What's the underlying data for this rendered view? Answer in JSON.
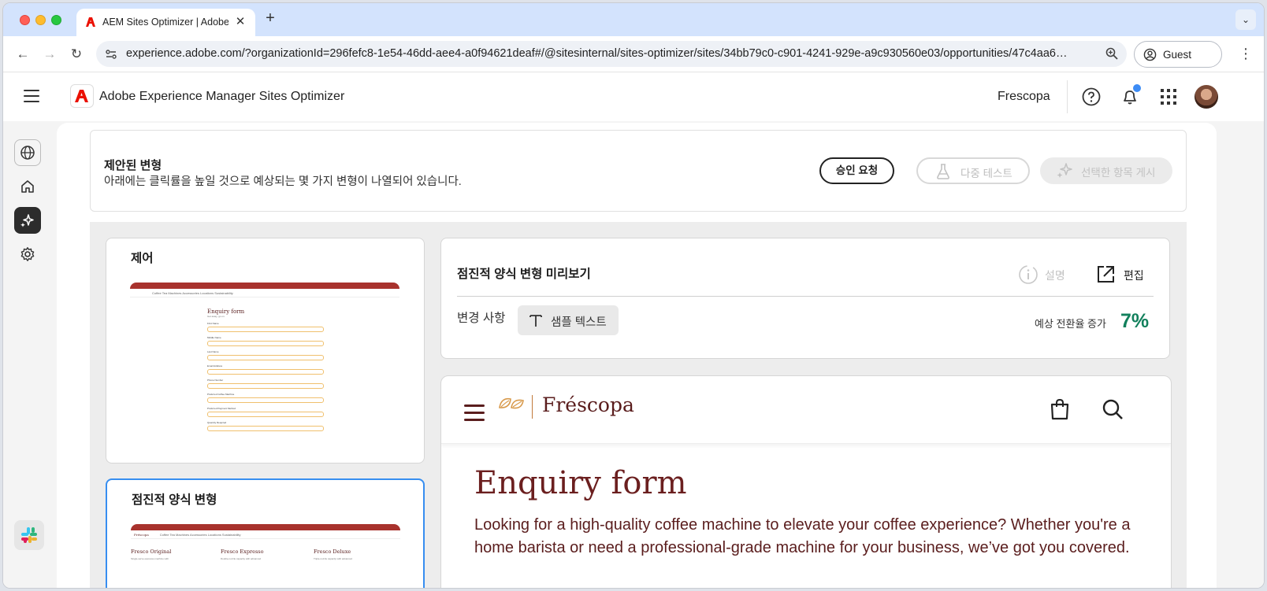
{
  "browser": {
    "tab_title": "AEM Sites Optimizer | Adobe Experience Manager",
    "url": "experience.adobe.com/?organizationId=296fefc8-1e54-46dd-aee4-a0f94621deaf#/@sitesinternal/sites-optimizer/sites/34bb79c0-c901-4241-929e-a9c930560e03/opportunities/47c4aa6…",
    "profile_label": "Guest"
  },
  "app": {
    "title": "Adobe Experience Manager Sites Optimizer",
    "org_name": "Frescopa"
  },
  "suggestion": {
    "title": "제안된 변형",
    "description": "아래에는 클릭률을 높일 것으로 예상되는 몇 가지 변형이 나열되어 있습니다.",
    "approve_label": "승인 요청",
    "multitest_label": "다중 테스트",
    "publish_label": "선택한 항목 게시"
  },
  "variants": [
    {
      "title": "제어",
      "thumb": {
        "heading": "Enquiry form",
        "sub": "Get away, go on.",
        "fields": [
          "First Name",
          "Middle Name",
          "Last Name",
          "Email Address",
          "Phone Number",
          "Preferred Coffee Machine",
          "Preferred Payment Method",
          "Quantity Required"
        ]
      }
    },
    {
      "title": "점진적 양식 변형",
      "thumb": {
        "columns": [
          {
            "name": "Fresco Original",
            "sub": "Single-serve espresso machine with"
          },
          {
            "name": "Fresco Expresso",
            "sub": "Double-nozzle capacity with advanced"
          },
          {
            "name": "Fresco Deluxe",
            "sub": "Triple-nozzle capacity with advanced"
          }
        ]
      }
    }
  ],
  "thumb_banner": "FREE SHIPPING FROM $50 & FREE COFFEE SAMPLES WITH EVERY PURCHASE",
  "thumb_nav": "Coffee    Tea    Machines    Accessories    Locations    Sustainability",
  "preview": {
    "title": "점진적 양식 변형 미리보기",
    "explain_label": "설명",
    "edit_label": "편집",
    "changes_label": "변경 사항",
    "chip_label": "샘플 텍스트",
    "conversion_label": "예상 전환율 증가",
    "conversion_value": "7%"
  },
  "site": {
    "brand": "Fréscopa",
    "heading": "Enquiry form",
    "intro": "Looking for a high-quality coffee machine to elevate your coffee experience? Whether you're a home barista or need a professional-grade machine for your business, we’ve got you covered."
  },
  "colors": {
    "accent_blue": "#378ef0",
    "positive_green": "#12805c",
    "brand_maroon": "#5a1d1d",
    "adobe_red": "#eb1000"
  }
}
